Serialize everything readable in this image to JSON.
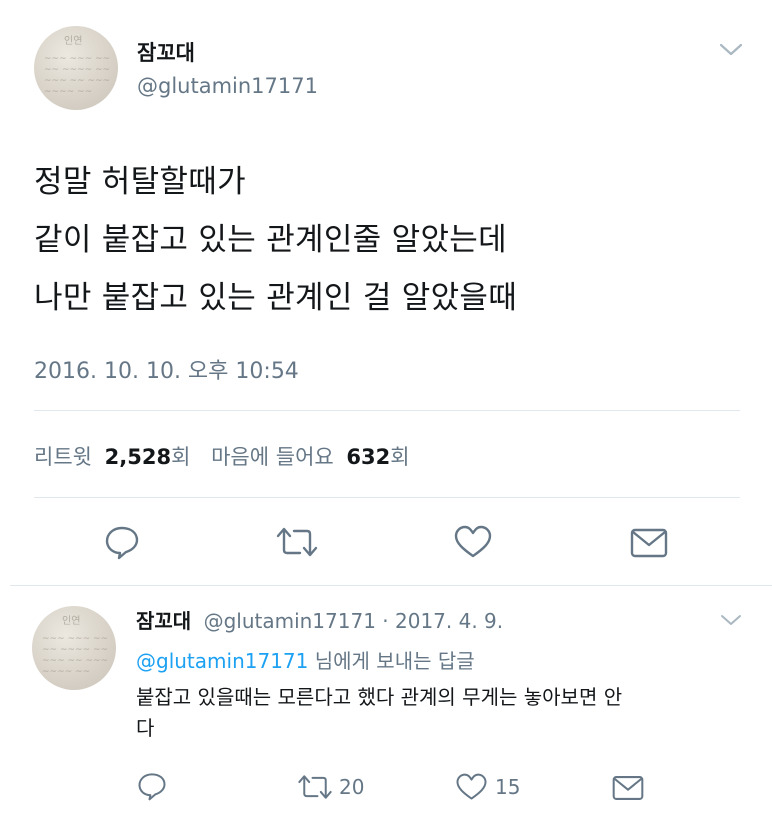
{
  "main_tweet": {
    "display_name": "잠꼬대",
    "handle": "@glutamin17171",
    "lines": [
      "정말 허탈할때가",
      "같이 붙잡고 있는 관계인줄 알았는데",
      "나만 붙잡고 있는 관계인 걸 알았을때"
    ],
    "timestamp": "2016. 10. 10. 오후 10:54",
    "retweet_label": "리트윗",
    "retweet_count": "2,528",
    "count_suffix": "회",
    "like_label": "마음에 들어요",
    "like_count": "632"
  },
  "avatar_text": "인연",
  "reply_tweet": {
    "display_name": "잠꼬대",
    "handle_date": "@glutamin17171 · 2017. 4. 9.",
    "reply_to_handle": "@glutamin17171",
    "reply_to_suffix": " 님에게 보내는 답글",
    "text_line1": "붙잡고 있을때는 모른다고 했다 관계의 무게는 놓아보면 안",
    "text_line2": "다",
    "retweet_count": "20",
    "like_count": "15"
  },
  "icons": {
    "reply": "reply-icon",
    "retweet": "retweet-icon",
    "like": "heart-icon",
    "message": "envelope-icon",
    "more": "chevron-down-icon"
  },
  "colors": {
    "text": "#14171a",
    "secondary": "#657786",
    "link": "#1da1f2",
    "divider": "#e1e8ed"
  }
}
